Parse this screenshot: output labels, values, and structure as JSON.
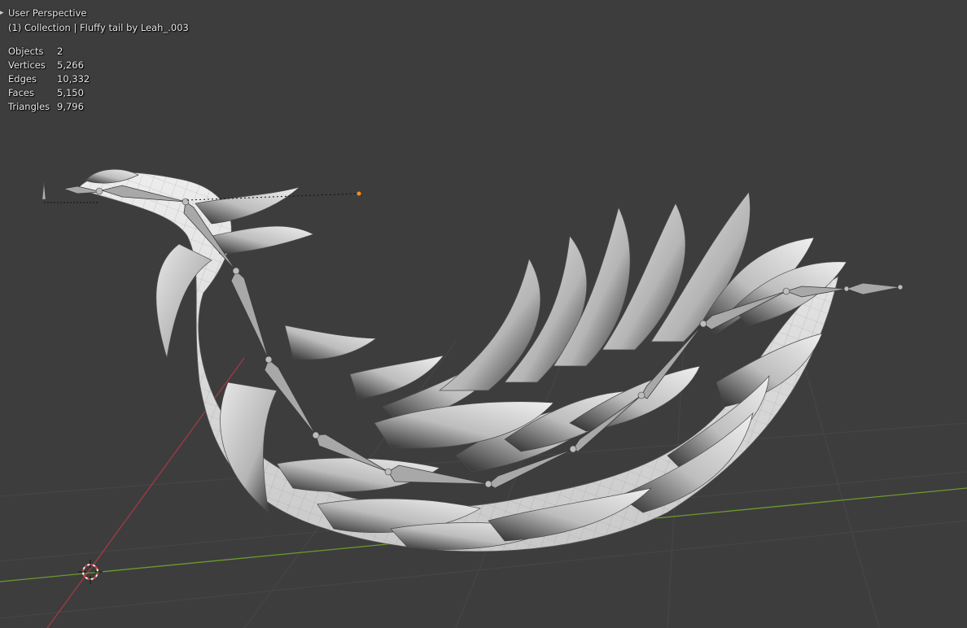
{
  "viewport": {
    "view_name": "User Perspective",
    "collection_info": "(1) Collection | Fluffy tail by Leah_.003"
  },
  "stats": [
    {
      "label": "Objects",
      "value": "2"
    },
    {
      "label": "Vertices",
      "value": "5,266"
    },
    {
      "label": "Edges",
      "value": "10,332"
    },
    {
      "label": "Faces",
      "value": "5,150"
    },
    {
      "label": "Triangles",
      "value": "9,796"
    }
  ],
  "colors": {
    "background": "#3d3d3d",
    "grid_line": "#4a4a4a",
    "x_axis": "#a03a45",
    "y_axis": "#6b9a2f",
    "mesh_light": "#e2e2e2",
    "mesh_dark": "#1e1e1e",
    "bone": "#a8a8a8",
    "light_dot": "#ff8c1a",
    "cursor_red": "#e04040"
  },
  "icons": {
    "expand": "chevron-right-icon",
    "cursor": "3d-cursor-icon",
    "light": "light-source-icon",
    "camera": "empty-object-icon"
  }
}
